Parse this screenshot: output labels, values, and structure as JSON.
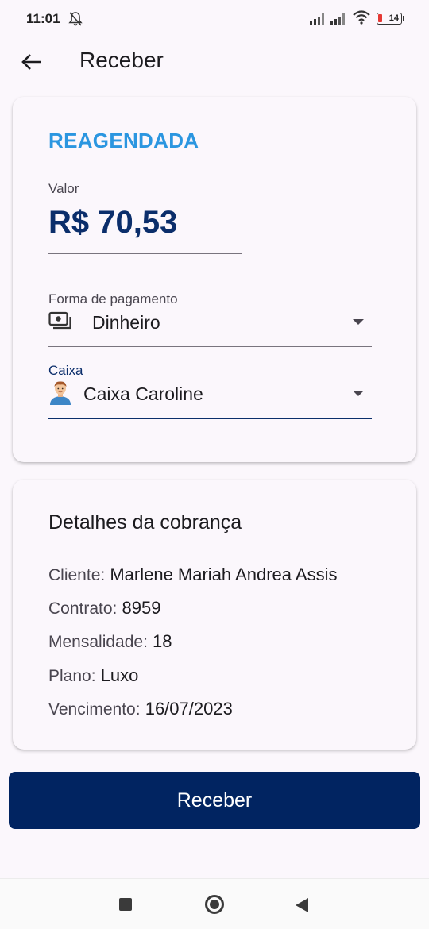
{
  "status_bar": {
    "time": "11:01",
    "battery": "14",
    "icons": [
      "bell-off-icon",
      "signal-icon",
      "signal-icon",
      "wifi-icon",
      "battery-icon"
    ]
  },
  "app_bar": {
    "back_icon": "arrow-left-icon",
    "title": "Receber"
  },
  "payment_card": {
    "status": "REAGENDADA",
    "value_label": "Valor",
    "value": "R$ 70,53",
    "payment_method": {
      "label": "Forma de pagamento",
      "icon": "cash-icon",
      "value": "Dinheiro"
    },
    "cashier": {
      "label": "Caixa",
      "icon": "avatar",
      "value": "Caixa Caroline"
    }
  },
  "details_card": {
    "title": "Detalhes da cobrança",
    "lines": [
      {
        "key": "Cliente:",
        "value": "Marlene Mariah Andrea Assis"
      },
      {
        "key": "Contrato:",
        "value": "8959"
      },
      {
        "key": "Mensalidade:",
        "value": "18"
      },
      {
        "key": "Plano:",
        "value": "Luxo"
      },
      {
        "key": "Vencimento:",
        "value": "16/07/2023"
      }
    ]
  },
  "primary_button": {
    "label": "Receber"
  },
  "colors": {
    "status_accent": "#2b96e0",
    "brand_navy": "#012461",
    "value_navy": "#0b2e6b"
  }
}
